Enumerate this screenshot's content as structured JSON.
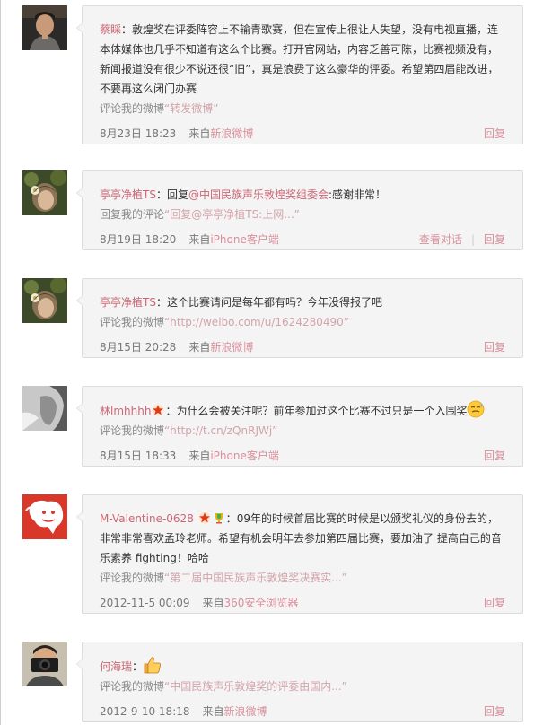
{
  "comments": [
    {
      "user": "蔡睬",
      "sep": "：",
      "text": "敦煌奖在评委阵容上不输青歌赛，但在宣传上很让人失望，没有电视直播，连本体媒体也几乎不知道有这么个比赛。打开官网站，内容乏善可陈，比赛视频没有，新闻报道没有很少不说还很“旧”，真是浪费了这么豪华的评委。希望第四届能改进，不要再这么闭门办赛",
      "meta_prefix": "评论我的微博",
      "meta_quote": "“转发微博”",
      "date": "8月23日 18:23",
      "source_prefix": "来自",
      "source": "新浪微博",
      "actions": [
        "回复"
      ]
    },
    {
      "user": "亭亭净植TS",
      "sep": "：",
      "text_prefix": "回复",
      "mention": "@中国民族声乐敦煌奖组委会",
      "text": ":感谢非常！",
      "meta_prefix": "回复我的评论",
      "meta_quote": "“回复@亭亭净植TS:上网...”",
      "date": "8月19日 18:20",
      "source_prefix": "来自",
      "source": "iPhone客户端",
      "actions": [
        "查看对话",
        "回复"
      ]
    },
    {
      "user": "亭亭净植TS",
      "sep": "：",
      "text": "这个比赛请问是每年都有吗？今年没得报了吧",
      "meta_prefix": "评论我的微博",
      "meta_quote": "“http://weibo.com/u/1624280490”",
      "date": "8月15日 20:28",
      "source_prefix": "来自",
      "source": "新浪微博",
      "actions": [
        "回复"
      ]
    },
    {
      "user": "林lmhhhh",
      "sep": "：",
      "text": "为什么会被关注呢？前年参加过这个比赛不过只是一个入围奖",
      "meta_prefix": "评论我的微博",
      "meta_quote": "“http://t.cn/zQnRJWj”",
      "date": "8月15日 18:33",
      "source_prefix": "来自",
      "source": "iPhone客户端",
      "actions": [
        "回复"
      ]
    },
    {
      "user": "M-Valentine-0628",
      "sep": "：",
      "text": "09年的时候首届比赛的时候是以颁奖礼仪的身份去的，非常非常喜欢孟玲老师。希望有机会明年去参加第四届比赛，要加油了 提高自己的音乐素养 fighting！哈哈",
      "meta_prefix": "评论我的微博",
      "meta_quote": "“第二届中国民族声乐敦煌奖决赛实...”",
      "date": "2012-11-5 00:09",
      "source_prefix": "来自",
      "source": "360安全浏览器",
      "actions": [
        "回复"
      ]
    },
    {
      "user": "何海瑞",
      "sep": "：",
      "text": "",
      "meta_prefix": "评论我的微博",
      "meta_quote": "“中国民族声乐敦煌奖的评委由国内...”",
      "date": "2012-9-10 18:18",
      "source_prefix": "来自",
      "source": "新浪微博",
      "actions": [
        "回复"
      ]
    }
  ],
  "colors": {
    "link": "#cc6674",
    "action": "#d98f9c",
    "bubble_bg": "#f4f4f4",
    "bubble_border": "#dcdcdc"
  }
}
